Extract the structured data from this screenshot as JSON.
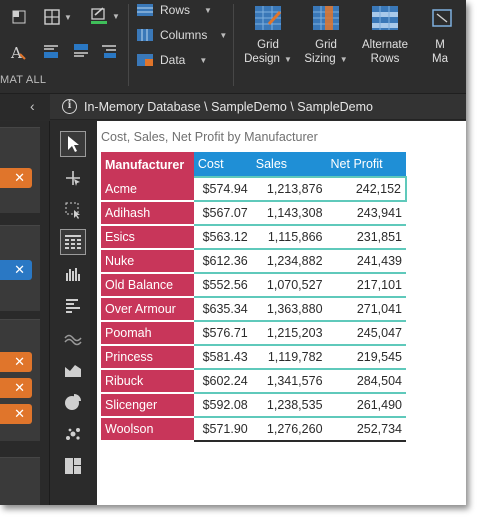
{
  "ribbon": {
    "group_label": "MAT ALL",
    "row_label": "Rows",
    "columns_label": "Columns",
    "data_label": "Data",
    "grid_design": {
      "line1": "Grid",
      "line2": "Design"
    },
    "grid_sizing": {
      "line1": "Grid",
      "line2": "Sizing"
    },
    "alternate_rows": {
      "line1": "Alternate",
      "line2": "Rows"
    },
    "more": {
      "line1": "M",
      "line2": "Ma"
    }
  },
  "breadcrumb": {
    "path": "In-Memory Database \\ SampleDemo \\ SampleDemo"
  },
  "left_panel": {
    "chip_glyph": "✕"
  },
  "visual": {
    "title": "Cost, Sales, Net Profit by Manufacturer",
    "headers": [
      "Manufacturer",
      "Cost",
      "Sales",
      "Net Profit"
    ],
    "rows": [
      [
        "Acme",
        "$574.94",
        "1,213,876",
        "242,152"
      ],
      [
        "Adihash",
        "$567.07",
        "1,143,308",
        "243,941"
      ],
      [
        "Esics",
        "$563.12",
        "1,115,866",
        "231,851"
      ],
      [
        "Nuke",
        "$612.36",
        "1,234,882",
        "241,439"
      ],
      [
        "Old Balance",
        "$552.56",
        "1,070,527",
        "217,101"
      ],
      [
        "Over Armour",
        "$635.34",
        "1,363,880",
        "271,041"
      ],
      [
        "Poomah",
        "$576.71",
        "1,215,203",
        "245,047"
      ],
      [
        "Princess",
        "$581.43",
        "1,119,782",
        "219,545"
      ],
      [
        "Ribuck",
        "$602.24",
        "1,341,576",
        "284,504"
      ],
      [
        "Slicenger",
        "$592.08",
        "1,238,535",
        "261,490"
      ],
      [
        "Woolson",
        "$571.90",
        "1,276,260",
        "252,734"
      ]
    ]
  },
  "colors": {
    "manufacturer_header": "#c8365a",
    "column_header": "#1f8fd6",
    "row_divider": "#5fc9bb",
    "app_background": "#2b2b2b"
  }
}
